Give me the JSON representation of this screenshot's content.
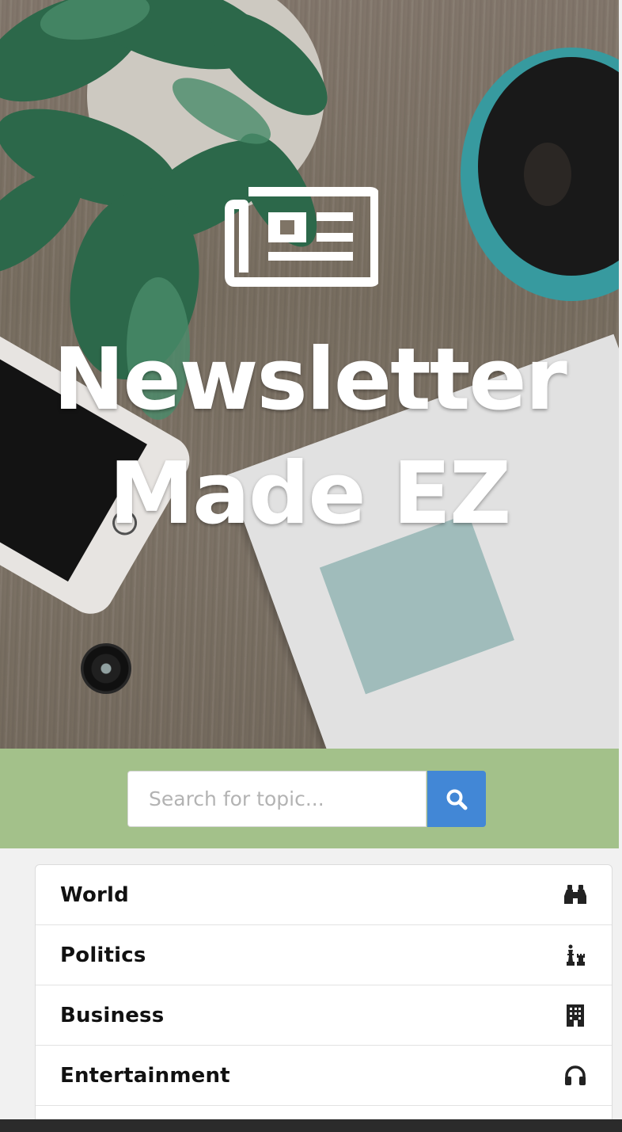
{
  "hero": {
    "title_line1": "Newsletter",
    "title_line2": "Made EZ",
    "icon": "newspaper-icon"
  },
  "search": {
    "placeholder": "Search for topic...",
    "value": "",
    "button_icon": "search-icon",
    "band_color": "#a3c18a",
    "button_color": "#4287d6"
  },
  "topics": [
    {
      "label": "World",
      "icon": "binoculars-icon"
    },
    {
      "label": "Politics",
      "icon": "chess-icon"
    },
    {
      "label": "Business",
      "icon": "building-icon"
    },
    {
      "label": "Entertainment",
      "icon": "headphones-icon"
    },
    {
      "label": "",
      "icon": ""
    }
  ]
}
